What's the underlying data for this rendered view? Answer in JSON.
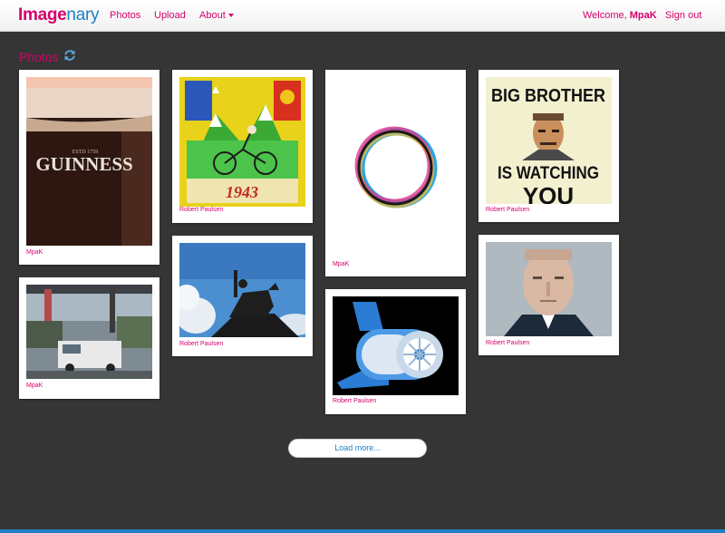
{
  "brand": {
    "part1": "Image",
    "part2": "nary"
  },
  "nav": {
    "photos": "Photos",
    "upload": "Upload",
    "about": "About"
  },
  "user": {
    "welcome": "Welcome,",
    "name": "MpaK",
    "sign_out": "Sign out"
  },
  "page": {
    "title": "Photos"
  },
  "photos": [
    {
      "author": "MpaK",
      "image_text": "GUINNESS"
    },
    {
      "author": "MpaK"
    },
    {
      "author": "Robert Paulsen",
      "image_text": "1943"
    },
    {
      "author": "Robert Paulsen"
    },
    {
      "author": "MpaK"
    },
    {
      "author": "Robert Paulsen"
    },
    {
      "author": "Robert Paulsen",
      "image_text": "BIG BROTHER IS WATCHING YOU"
    },
    {
      "author": "Robert Paulsen"
    }
  ],
  "load_more": "Load more...",
  "colors": {
    "accent": "#d6006b",
    "brand_blue": "#1e7fc4",
    "background": "#353535"
  }
}
